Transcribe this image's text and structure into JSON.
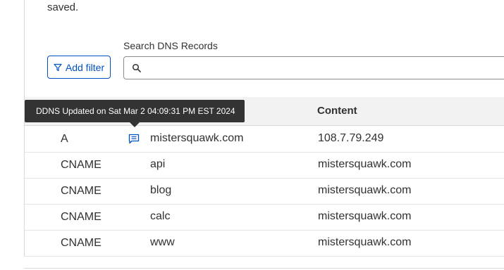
{
  "intro": {
    "text": "saved."
  },
  "filter": {
    "add_filter_label": "Add filter"
  },
  "search": {
    "label": "Search DNS Records",
    "value": "",
    "placeholder": ""
  },
  "table": {
    "header_content": "Content",
    "rows": [
      {
        "type": "A",
        "name": "mistersquawk.com",
        "content": "108.7.79.249",
        "has_comment": true
      },
      {
        "type": "CNAME",
        "name": "api",
        "content": "mistersquawk.com",
        "has_comment": false
      },
      {
        "type": "CNAME",
        "name": "blog",
        "content": "mistersquawk.com",
        "has_comment": false
      },
      {
        "type": "CNAME",
        "name": "calc",
        "content": "mistersquawk.com",
        "has_comment": false
      },
      {
        "type": "CNAME",
        "name": "www",
        "content": "mistersquawk.com",
        "has_comment": false
      }
    ]
  },
  "tooltip": {
    "text": "DDNS Updated on Sat Mar 2 04:09:31 PM EST 2024"
  },
  "icons": {
    "filter": "filter-icon",
    "search": "search-icon",
    "comment": "comment-icon"
  },
  "colors": {
    "accent": "#0051c3",
    "tooltip_bg": "#333333",
    "header_bg": "#f2f2f2"
  }
}
